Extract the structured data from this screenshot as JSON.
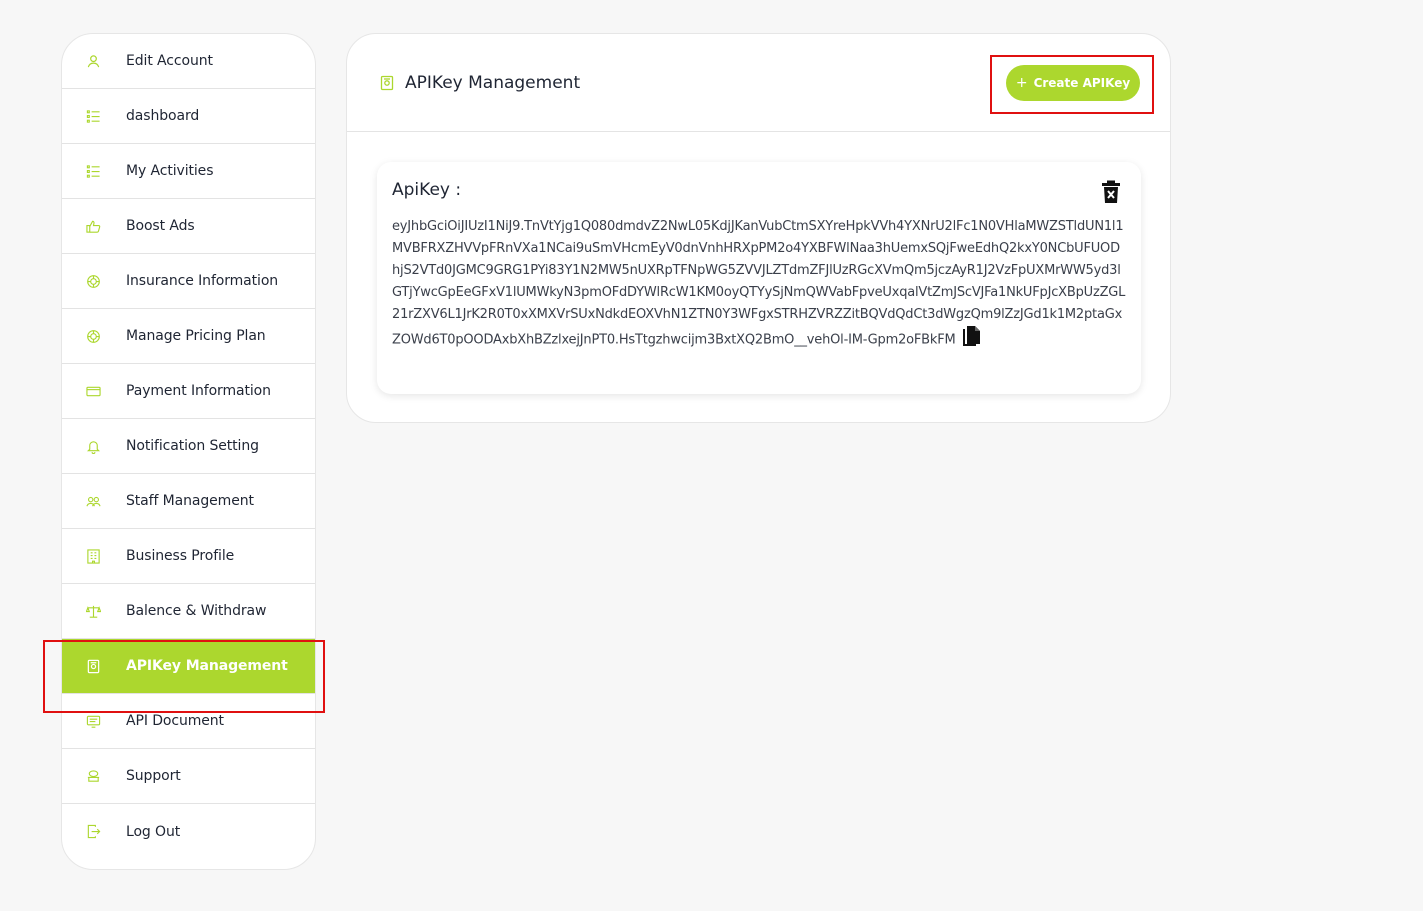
{
  "sidebar": {
    "items": [
      {
        "label": "Edit Account",
        "icon": "user-icon"
      },
      {
        "label": "dashboard",
        "icon": "list-icon"
      },
      {
        "label": "My Activities",
        "icon": "list-icon"
      },
      {
        "label": "Boost Ads",
        "icon": "thumbs-up-icon"
      },
      {
        "label": "Insurance Information",
        "icon": "badge-icon"
      },
      {
        "label": "Manage Pricing Plan",
        "icon": "badge-icon"
      },
      {
        "label": "Payment Information",
        "icon": "card-icon"
      },
      {
        "label": "Notification Setting",
        "icon": "bell-icon"
      },
      {
        "label": "Staff Management",
        "icon": "users-icon"
      },
      {
        "label": "Business Profile",
        "icon": "building-icon"
      },
      {
        "label": "Balence & Withdraw",
        "icon": "scale-icon"
      },
      {
        "label": "APIKey Management",
        "icon": "key-shield-icon"
      },
      {
        "label": "API Document",
        "icon": "document-icon"
      },
      {
        "label": "Support",
        "icon": "support-icon"
      },
      {
        "label": "Log Out",
        "icon": "logout-icon"
      }
    ],
    "active_index": 11
  },
  "main": {
    "title": "APIKey Management",
    "create_button": "Create APIKey",
    "key_title": "ApiKey :",
    "api_key": "eyJhbGciOiJIUzI1NiJ9.TnVtYjg1Q080dmdvZ2NwL05KdjJKanVubCtmSXYreHpkVVh4YXNrU2lFc1N0VHlaMWZSTldUN1l1MVBFRXZHVVpFRnVXa1NCai9uSmVHcmEyV0dnVnhHRXpPM2o4YXBFWlNaa3hUemxSQjFweEdhQ2kxY0NCbUFUODhjS2VTd0JGMC9GRG1PYi83Y1N2MW5nUXRpTFNpWG5ZVVJLZTdmZFJlUzRGcXVmQm5jczAyR1J2VzFpUXMrWW5yd3lGTjYwcGpEeGFxV1lUMWkyN3pmOFdDYWlRcW1KM0oyQTYySjNmQWVabFpveUxqalVtZmJScVJFa1NkUFpJcXBpUzZGL21rZXV6L1JrK2R0T0xXMXVrSUxNdkdEOXVhN1ZTN0Y3WFgxSTRHZVRZZitBQVdQdCt3dWgzQm9lZzJGd1k1M2ptaGxZOWd6T0pOODAxbXhBZzlxejJnPT0.HsTtgzhwcijm3BxtXQ2BmO__vehOl-IM-Gpm2oFBkFM"
  },
  "colors": {
    "accent": "#acd72e",
    "highlight": "#e01010"
  }
}
